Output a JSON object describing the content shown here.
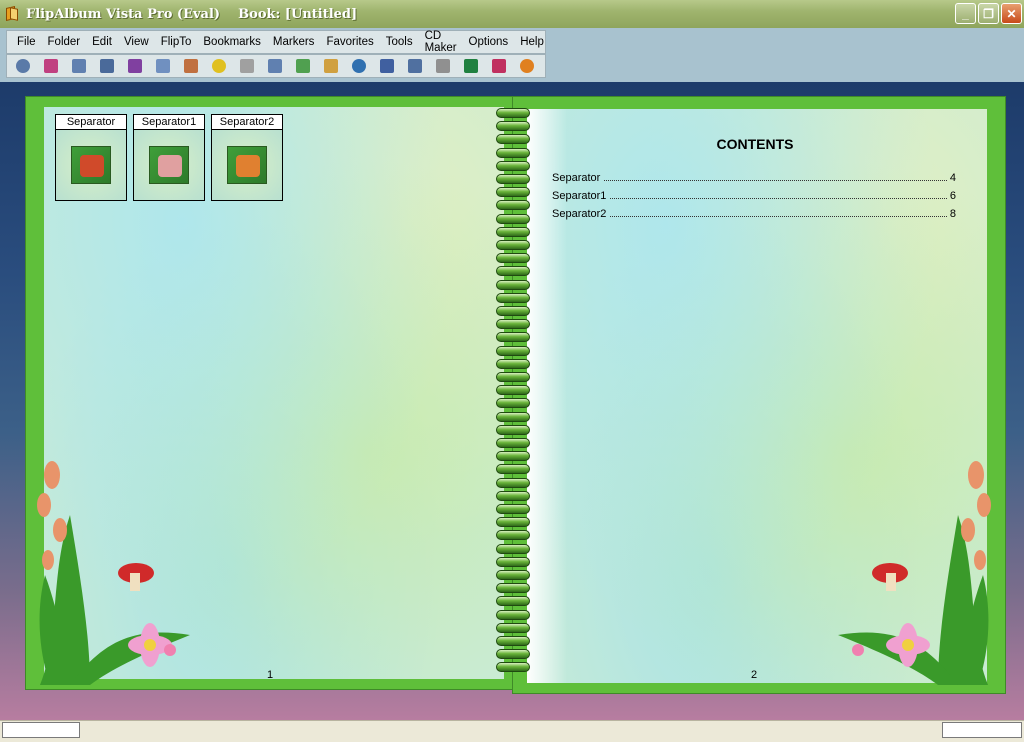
{
  "window": {
    "title": "FlipAlbum Vista Pro (Eval)    Book: [Untitled]",
    "buttons": [
      "_",
      "❐",
      "✕"
    ]
  },
  "menu": [
    "File",
    "Folder",
    "Edit",
    "View",
    "FlipTo",
    "Bookmarks",
    "Markers",
    "Favorites",
    "Tools",
    "CD Maker",
    "Options",
    "Help"
  ],
  "toolbar": {
    "icons": [
      "view-eye-icon",
      "page-single-icon",
      "page-spread-icon",
      "page-right-icon",
      "goto-icon",
      "two-pages-icon",
      "copy-page-icon",
      "add-icon",
      "edit-icon",
      "columns-icon",
      "link-icon",
      "contents-icon",
      "rotate-icon",
      "fit-width-icon",
      "slideshow-icon",
      "crop-icon",
      "globe-icon",
      "pointer-icon",
      "cd-icon"
    ],
    "colors": [
      "#5a7aa8",
      "#c04080",
      "#6080b0",
      "#4a6a9a",
      "#8040a0",
      "#7090c0",
      "#c07040",
      "#e0c020",
      "#a0a0a0",
      "#6080b0",
      "#50a050",
      "#d0a040",
      "#3070b0",
      "#4060a0",
      "#5070a0",
      "#909090",
      "#208040",
      "#c03060",
      "#e08020"
    ]
  },
  "book": {
    "left_page_number": "1",
    "right_page_number": "2",
    "thumbnails": [
      {
        "label": "Separator",
        "color": "#d04a2a"
      },
      {
        "label": "Separator1",
        "color": "#e0a0a0"
      },
      {
        "label": "Separator2",
        "color": "#e08030"
      }
    ],
    "contents": {
      "title": "CONTENTS",
      "entries": [
        {
          "label": "Separator",
          "page": "4"
        },
        {
          "label": "Separator1",
          "page": "6"
        },
        {
          "label": "Separator2",
          "page": "8"
        }
      ]
    }
  }
}
